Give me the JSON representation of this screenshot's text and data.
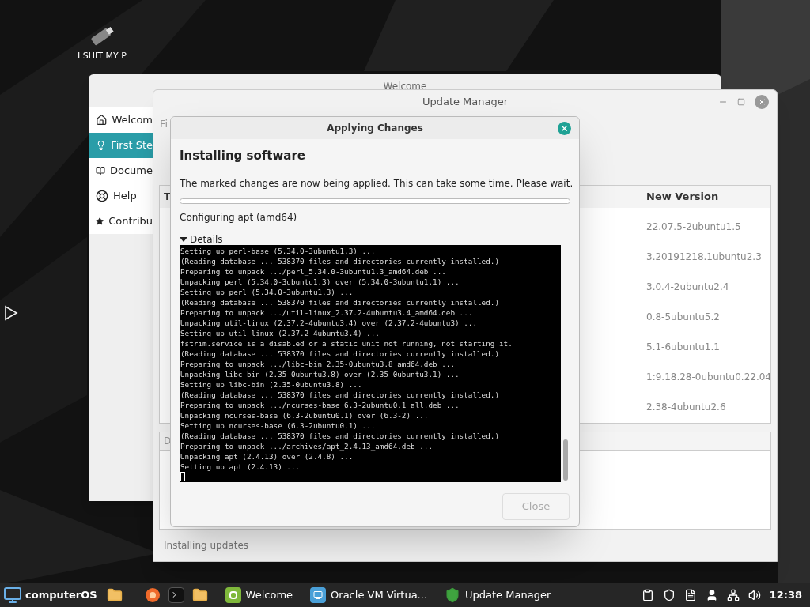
{
  "desktop": {
    "icons": [
      {
        "label": "I SHIT MY P"
      }
    ]
  },
  "welcome_window": {
    "title": "Welcome",
    "sidebar": {
      "items": [
        {
          "label": "Welcom",
          "selected": false
        },
        {
          "label": "First Ste",
          "selected": true
        },
        {
          "label": "Docume",
          "selected": false
        },
        {
          "label": "Help",
          "selected": false
        },
        {
          "label": "Contribu",
          "selected": false
        }
      ]
    }
  },
  "update_manager": {
    "title": "Update Manager",
    "menu": [
      "Fi"
    ],
    "table": {
      "columns": [
        "T",
        "New Version"
      ],
      "rows": [
        {
          "new_version": "22.07.5-2ubuntu1.5"
        },
        {
          "new_version": "3.20191218.1ubuntu2.3"
        },
        {
          "new_version": "3.0.4-2ubuntu2.4"
        },
        {
          "new_version": "0.8-5ubuntu5.2"
        },
        {
          "new_version": "5.1-6ubuntu1.1"
        },
        {
          "new_version": "1:9.18.28-0ubuntu0.22.04"
        },
        {
          "new_version": "2.38-4ubuntu2.6"
        }
      ]
    },
    "description_tab": "D",
    "status_bar": "Installing updates"
  },
  "dialog": {
    "title": "Applying Changes",
    "heading": "Installing software",
    "message": "The marked changes are now being applied. This can take some time. Please wait.",
    "progress": {
      "level": 0
    },
    "status": "Configuring apt (amd64)",
    "details": {
      "label": "Details",
      "expanded": true,
      "terminal": [
        "Setting up perl-base (5.34.0-3ubuntu1.3) ...",
        "(Reading database ... 538370 files and directories currently installed.)",
        "Preparing to unpack .../perl_5.34.0-3ubuntu1.3_amd64.deb ...",
        "Unpacking perl (5.34.0-3ubuntu1.3) over (5.34.0-3ubuntu1.1) ...",
        "Setting up perl (5.34.0-3ubuntu1.3) ...",
        "(Reading database ... 538370 files and directories currently installed.)",
        "Preparing to unpack .../util-linux_2.37.2-4ubuntu3.4_amd64.deb ...",
        "Unpacking util-linux (2.37.2-4ubuntu3.4) over (2.37.2-4ubuntu3) ...",
        "Setting up util-linux (2.37.2-4ubuntu3.4) ...",
        "fstrim.service is a disabled or a static unit not running, not starting it.",
        "(Reading database ... 538370 files and directories currently installed.)",
        "Preparing to unpack .../libc-bin_2.35-0ubuntu3.8_amd64.deb ...",
        "Unpacking libc-bin (2.35-0ubuntu3.8) over (2.35-0ubuntu3.1) ...",
        "Setting up libc-bin (2.35-0ubuntu3.8) ...",
        "(Reading database ... 538370 files and directories currently installed.)",
        "Preparing to unpack .../ncurses-base_6.3-2ubuntu0.1_all.deb ...",
        "Unpacking ncurses-base (6.3-2ubuntu0.1) over (6.3-2) ...",
        "Setting up ncurses-base (6.3-2ubuntu0.1) ...",
        "(Reading database ... 538370 files and directories currently installed.)",
        "Preparing to unpack .../archives/apt_2.4.13_amd64.deb ...",
        "Unpacking apt (2.4.13) over (2.4.8) ...",
        "Setting up apt (2.4.13) ..."
      ]
    },
    "close_button": {
      "label": "Close",
      "disabled": true
    }
  },
  "taskbar": {
    "menu_label": "computerOS",
    "launchers": [
      {
        "kind": "folder"
      },
      {
        "kind": "browser"
      },
      {
        "kind": "terminal"
      },
      {
        "kind": "folder"
      }
    ],
    "windows": [
      {
        "label": "Welcome"
      },
      {
        "label": "Oracle VM Virtua..."
      },
      {
        "label": "Update Manager"
      }
    ],
    "clock": "12:38"
  }
}
